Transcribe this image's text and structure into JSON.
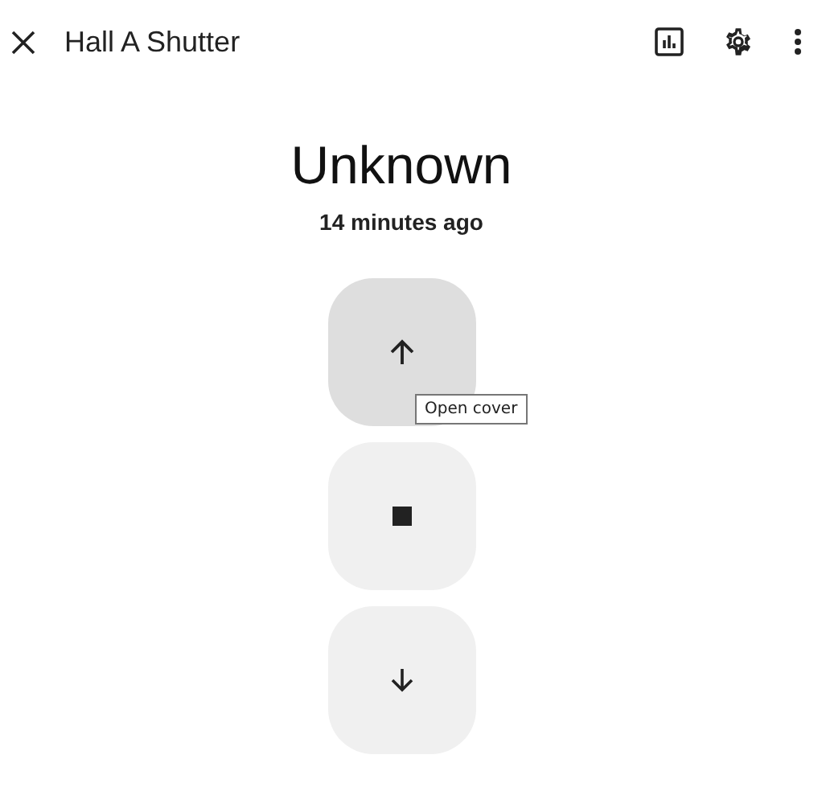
{
  "header": {
    "title": "Hall A Shutter"
  },
  "state": {
    "value": "Unknown",
    "last_changed": "14 minutes ago"
  },
  "controls": [
    {
      "kind": "open",
      "hovered": true
    },
    {
      "kind": "stop",
      "hovered": false
    },
    {
      "kind": "close",
      "hovered": false
    }
  ],
  "tooltip": {
    "text": "Open cover"
  }
}
